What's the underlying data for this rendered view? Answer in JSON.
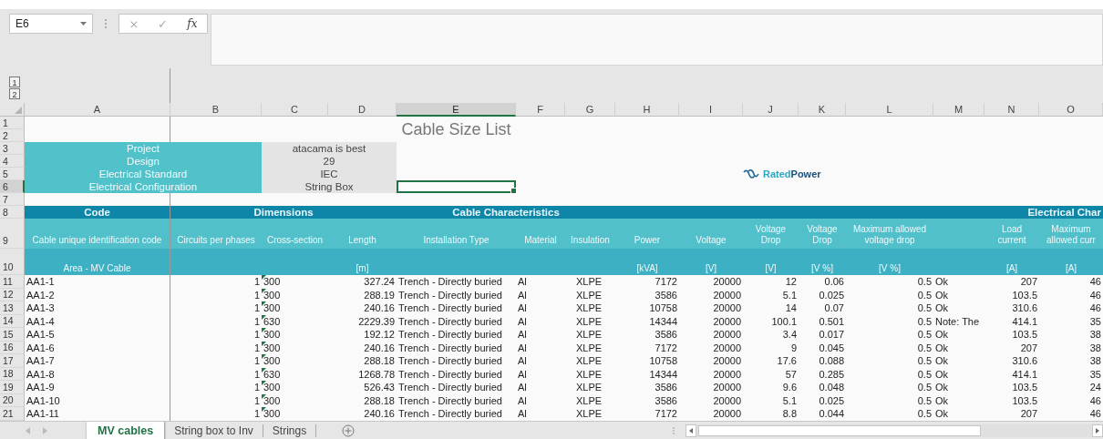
{
  "formula_bar": {
    "name_box": "E6",
    "cancel": "×",
    "enter": "✓",
    "function": "fx"
  },
  "outline_levels": [
    "1",
    "2"
  ],
  "column_headers": [
    {
      "label": "A",
      "selected": false
    },
    {
      "label": "B",
      "selected": false
    },
    {
      "label": "C",
      "selected": false
    },
    {
      "label": "D",
      "selected": false
    },
    {
      "label": "E",
      "selected": true
    },
    {
      "label": "F",
      "selected": false
    },
    {
      "label": "G",
      "selected": false
    },
    {
      "label": "H",
      "selected": false
    },
    {
      "label": "I",
      "selected": false
    },
    {
      "label": "J",
      "selected": false
    },
    {
      "label": "K",
      "selected": false
    },
    {
      "label": "L",
      "selected": false
    },
    {
      "label": "M",
      "selected": false
    },
    {
      "label": "N",
      "selected": false
    },
    {
      "label": "O",
      "selected": false
    }
  ],
  "row_headers": [
    {
      "label": "1",
      "selected": false
    },
    {
      "label": "2",
      "selected": false
    },
    {
      "label": "3",
      "selected": false
    },
    {
      "label": "4",
      "selected": false
    },
    {
      "label": "5",
      "selected": false
    },
    {
      "label": "6",
      "selected": true
    },
    {
      "label": "7",
      "selected": false
    },
    {
      "label": "8",
      "selected": false
    },
    {
      "label": "9",
      "selected": false
    },
    {
      "label": "10",
      "selected": false
    },
    {
      "label": "11",
      "selected": false
    },
    {
      "label": "12",
      "selected": false
    },
    {
      "label": "13",
      "selected": false
    },
    {
      "label": "14",
      "selected": false
    },
    {
      "label": "15",
      "selected": false
    },
    {
      "label": "16",
      "selected": false
    },
    {
      "label": "17",
      "selected": false
    },
    {
      "label": "18",
      "selected": false
    },
    {
      "label": "19",
      "selected": false
    },
    {
      "label": "20",
      "selected": false
    },
    {
      "label": "21",
      "selected": false
    }
  ],
  "title": "Cable Size List",
  "info": [
    {
      "label": "Project",
      "value": "atacama is best"
    },
    {
      "label": "Design",
      "value": "29"
    },
    {
      "label": "Electrical Standard",
      "value": "IEC"
    },
    {
      "label": "Electrical Configuration",
      "value": "String Box"
    }
  ],
  "logo": [
    "Rated",
    "Power"
  ],
  "groups": [
    "Code",
    "Dimensions",
    "Cable Characteristics",
    "Electrical Char"
  ],
  "columns": [
    {
      "title": "Cable unique identification code",
      "unit": "Area - MV Cable"
    },
    {
      "title": "Circuits per phases"
    },
    {
      "title": "Cross-section"
    },
    {
      "title": "Length",
      "unit": "[m]"
    },
    {
      "title": "Installation Type"
    },
    {
      "title": "Material"
    },
    {
      "title": "Insulation"
    },
    {
      "title": "Power",
      "unit": "[kVA]"
    },
    {
      "title": "Voltage",
      "unit": "[V]"
    },
    {
      "title": "Voltage Drop",
      "unit": "[V]"
    },
    {
      "title": "Voltage Drop",
      "unit": "[V %]"
    },
    {
      "title": "Maximum allowed voltage drop",
      "unit": "[V %]"
    },
    {},
    {
      "title": "Load current",
      "unit": "[A]"
    },
    {
      "title": "Maximum allowed curr",
      "unit": "[A]"
    }
  ],
  "cables": [
    {
      "code": "AA1-1",
      "circuits": "1",
      "section": "300",
      "flagged": true,
      "length": "327.24",
      "installation": "Trench - Directly buried",
      "material": "Al",
      "insulation": "XLPE",
      "power": "7172",
      "voltage": "20000",
      "drop": "12",
      "drop_pct": "0.06",
      "max_drop": "0.5",
      "check": "Ok",
      "load": "207",
      "column_O": "46"
    },
    {
      "code": "AA1-2",
      "circuits": "1",
      "section": "300",
      "flagged": true,
      "length": "288.19",
      "installation": "Trench - Directly buried",
      "material": "Al",
      "insulation": "XLPE",
      "power": "3586",
      "voltage": "20000",
      "drop": "5.1",
      "drop_pct": "0.025",
      "max_drop": "0.5",
      "check": "Ok",
      "load": "103.5",
      "column_O": "46"
    },
    {
      "code": "AA1-3",
      "circuits": "1",
      "section": "300",
      "flagged": true,
      "length": "240.16",
      "installation": "Trench - Directly buried",
      "material": "Al",
      "insulation": "XLPE",
      "power": "10758",
      "voltage": "20000",
      "drop": "14",
      "drop_pct": "0.07",
      "max_drop": "0.5",
      "check": "Ok",
      "load": "310.6",
      "column_O": "46"
    },
    {
      "code": "AA1-4",
      "circuits": "1",
      "section": "630",
      "flagged": true,
      "length": "2229.39",
      "installation": "Trench - Directly buried",
      "material": "Al",
      "insulation": "XLPE",
      "power": "14344",
      "voltage": "20000",
      "drop": "100.1",
      "drop_pct": "0.501",
      "max_drop": "0.5",
      "check": "Note: The",
      "load": "414.1",
      "column_O": "35"
    },
    {
      "code": "AA1-5",
      "circuits": "1",
      "section": "300",
      "flagged": true,
      "length": "192.12",
      "installation": "Trench - Directly buried",
      "material": "Al",
      "insulation": "XLPE",
      "power": "3586",
      "voltage": "20000",
      "drop": "3.4",
      "drop_pct": "0.017",
      "max_drop": "0.5",
      "check": "Ok",
      "load": "103.5",
      "column_O": "38"
    },
    {
      "code": "AA1-6",
      "circuits": "1",
      "section": "300",
      "flagged": true,
      "length": "240.16",
      "installation": "Trench - Directly buried",
      "material": "Al",
      "insulation": "XLPE",
      "power": "7172",
      "voltage": "20000",
      "drop": "9",
      "drop_pct": "0.045",
      "max_drop": "0.5",
      "check": "Ok",
      "load": "207",
      "column_O": "38"
    },
    {
      "code": "AA1-7",
      "circuits": "1",
      "section": "300",
      "flagged": true,
      "length": "288.18",
      "installation": "Trench - Directly buried",
      "material": "Al",
      "insulation": "XLPE",
      "power": "10758",
      "voltage": "20000",
      "drop": "17.6",
      "drop_pct": "0.088",
      "max_drop": "0.5",
      "check": "Ok",
      "load": "310.6",
      "column_O": "38"
    },
    {
      "code": "AA1-8",
      "circuits": "1",
      "section": "630",
      "flagged": true,
      "length": "1268.78",
      "installation": "Trench - Directly buried",
      "material": "Al",
      "insulation": "XLPE",
      "power": "14344",
      "voltage": "20000",
      "drop": "57",
      "drop_pct": "0.285",
      "max_drop": "0.5",
      "check": "Ok",
      "load": "414.1",
      "column_O": "35"
    },
    {
      "code": "AA1-9",
      "circuits": "1",
      "section": "300",
      "flagged": true,
      "length": "526.43",
      "installation": "Trench - Directly buried",
      "material": "Al",
      "insulation": "XLPE",
      "power": "3586",
      "voltage": "20000",
      "drop": "9.6",
      "drop_pct": "0.048",
      "max_drop": "0.5",
      "check": "Ok",
      "load": "103.5",
      "column_O": "24"
    },
    {
      "code": "AA1-10",
      "circuits": "1",
      "section": "300",
      "flagged": true,
      "length": "288.18",
      "installation": "Trench - Directly buried",
      "material": "Al",
      "insulation": "XLPE",
      "power": "3586",
      "voltage": "20000",
      "drop": "5.1",
      "drop_pct": "0.025",
      "max_drop": "0.5",
      "check": "Ok",
      "load": "103.5",
      "column_O": "46"
    },
    {
      "code": "AA1-11",
      "circuits": "1",
      "section": "300",
      "flagged": true,
      "length": "240.16",
      "installation": "Trench - Directly buried",
      "material": "Al",
      "insulation": "XLPE",
      "power": "7172",
      "voltage": "20000",
      "drop": "8.8",
      "drop_pct": "0.044",
      "max_drop": "0.5",
      "check": "Ok",
      "load": "207",
      "column_O": "46"
    }
  ],
  "sheet_tabs": [
    {
      "label": "MV cables",
      "selected": true
    },
    {
      "label": "String box to Inv",
      "selected": false
    },
    {
      "label": "Strings",
      "selected": false
    }
  ]
}
